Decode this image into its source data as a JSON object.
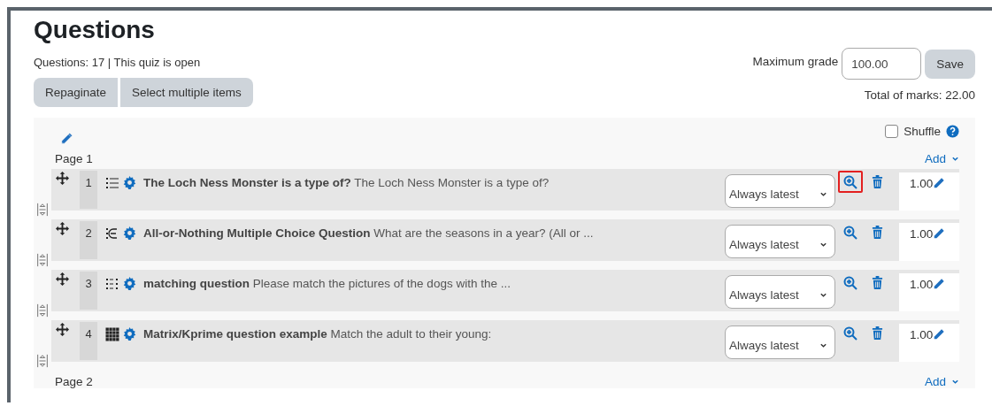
{
  "title": "Questions",
  "summary": "Questions: 17 | This quiz is open",
  "maximum_grade": {
    "label": "Maximum grade",
    "value": "100.00",
    "button": "Save"
  },
  "actions": [
    "Repaginate",
    "Select multiple items"
  ],
  "total_marks": "Total of marks: 22.00",
  "shuffle": {
    "label": "Shuffle",
    "checked": false
  },
  "pages": [
    {
      "label": "Page 1",
      "add": "Add",
      "questions": [
        {
          "number": "1",
          "kind": "multichoice",
          "name": "The Loch Ness Monster is a type of?",
          "text": "The Loch Ness Monster is a type of?",
          "version": "Always latest",
          "mark": "1.00",
          "highlighted": true
        },
        {
          "number": "2",
          "kind": "allornothing",
          "name": "All-or-Nothing Multiple Choice Question",
          "text": "What are the seasons in a year?  (All or ...",
          "version": "Always latest",
          "mark": "1.00",
          "highlighted": false
        },
        {
          "number": "3",
          "kind": "matching",
          "name": "matching question",
          "text": "Please match the pictures of the dogs with the ...",
          "version": "Always latest",
          "mark": "1.00",
          "highlighted": false
        },
        {
          "number": "4",
          "kind": "matrix",
          "name": "Matrix/Kprime question example",
          "text": "Match the adult to their young:",
          "version": "Always latest",
          "mark": "1.00",
          "highlighted": false
        }
      ]
    },
    {
      "label": "Page 2",
      "add": "Add"
    }
  ]
}
